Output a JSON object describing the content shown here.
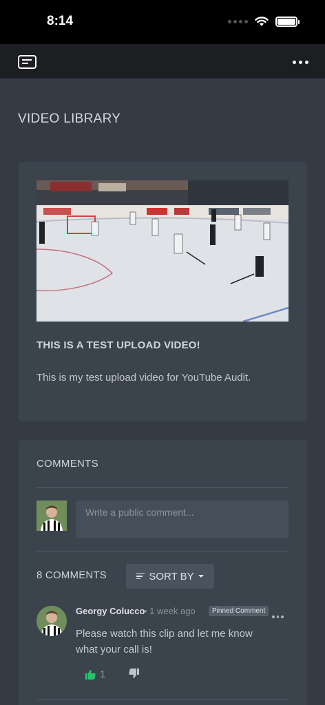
{
  "status_bar": {
    "time": "8:14"
  },
  "page": {
    "title": "VIDEO LIBRARY"
  },
  "video": {
    "title": "THIS IS A TEST UPLOAD VIDEO!",
    "description": "This is my test upload video for YouTube Audit."
  },
  "comments": {
    "heading": "COMMENTS",
    "input_placeholder": "Write a public comment...",
    "count_label": "8 COMMENTS",
    "sort_label": "SORT BY",
    "items": [
      {
        "author": "Georgy Colucco",
        "time": "• 1 week ago",
        "badge": "Pinned Comment",
        "text": "Please watch this clip and let me know what your call is!",
        "likes": "1"
      }
    ]
  },
  "colors": {
    "accent_like": "#27c26c",
    "background": "#343b44",
    "card": "#3b434d"
  },
  "icons": [
    "wifi-icon",
    "battery-icon",
    "menu-card-icon",
    "more-icon",
    "sort-icon",
    "thumbs-up-icon",
    "thumbs-down-icon"
  ]
}
